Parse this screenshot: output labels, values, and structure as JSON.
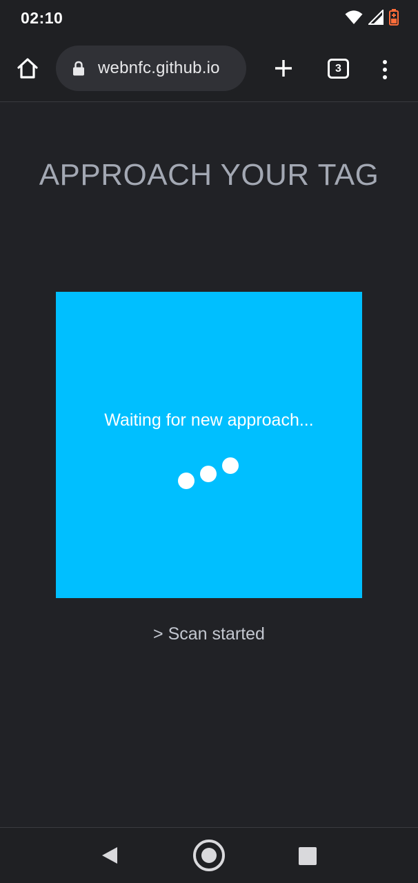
{
  "status_bar": {
    "time": "02:10",
    "icons": [
      "wifi-icon",
      "cell-signal-icon",
      "battery-icon"
    ],
    "battery_color": "#ff6d3a"
  },
  "browser": {
    "url": "webnfc.github.io",
    "tab_count": "3",
    "icons": [
      "home-icon",
      "lock-icon",
      "plus-icon",
      "tabs-icon",
      "more-vert-icon"
    ]
  },
  "page": {
    "title": "APPROACH YOUR TAG",
    "scan_message": "Waiting for new approach...",
    "log": "> Scan started",
    "colors": {
      "background": "#212226",
      "title": "#a3a8b3",
      "scan_box": "#00bfff"
    }
  },
  "nav_bar": {
    "icons": [
      "back-icon",
      "home-circle-icon",
      "recents-icon"
    ]
  }
}
